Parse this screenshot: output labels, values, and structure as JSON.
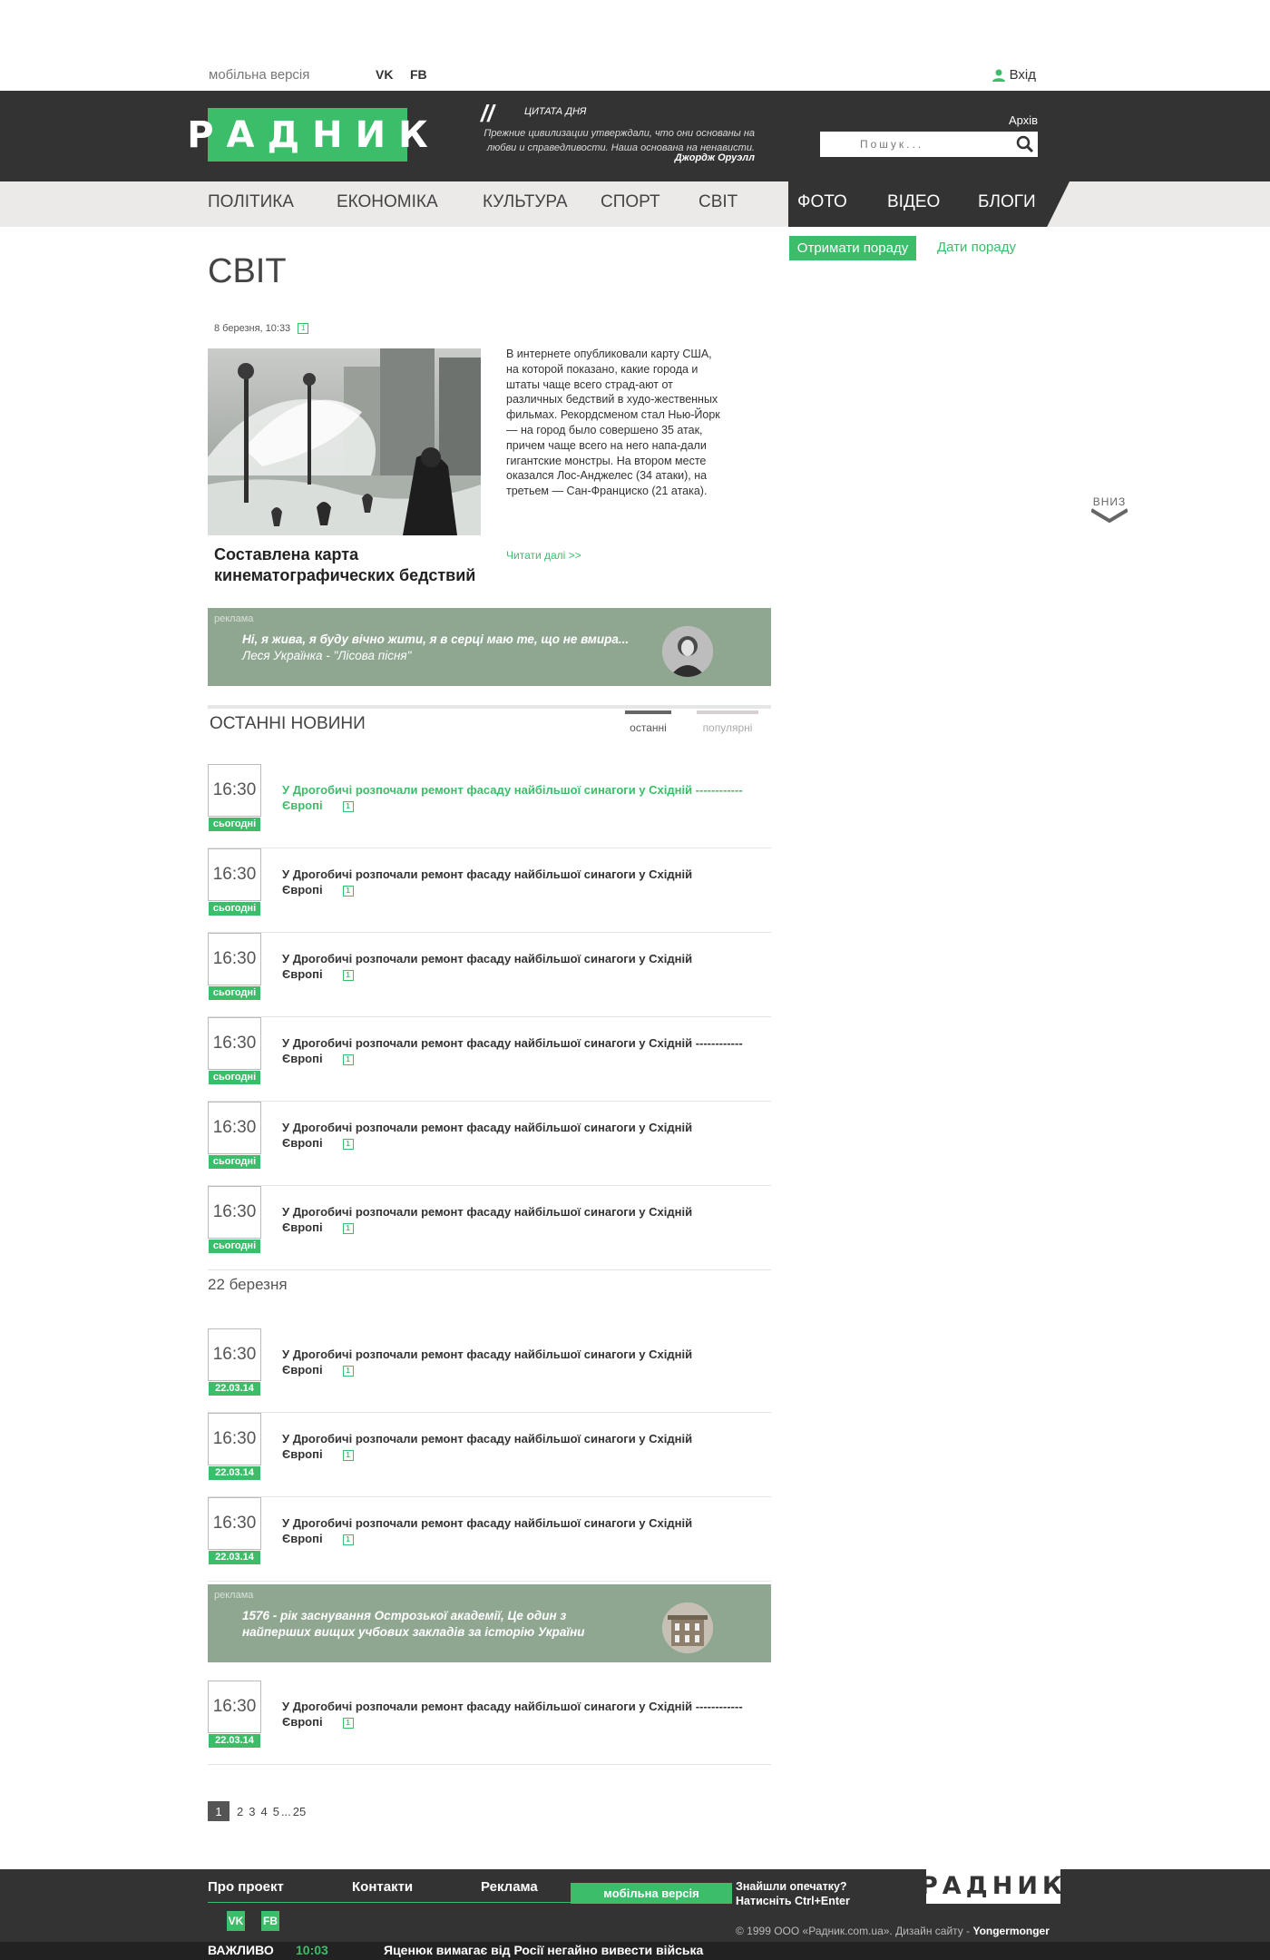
{
  "topbar": {
    "mobile_version": "мобільна версія",
    "vk": "VK",
    "fb": "FB",
    "login": "Вхід"
  },
  "header": {
    "logo": "РАДНИК",
    "quote_title": "ЦИТАТА ДНЯ",
    "quote_text": "Прежние цивилизации утверждали, что они основаны на любви и справедливости. Наша основана на ненависти.",
    "quote_author": "Джордж Оруэлл",
    "archive": "Архів",
    "search_placeholder": "Пошук..."
  },
  "nav": {
    "items": [
      "ПОЛІТИКА",
      "ЕКОНОМІКА",
      "КУЛЬТУРА",
      "СПОРТ",
      "СВІТ",
      "ФОТО",
      "ВІДЕО",
      "БЛОГИ"
    ]
  },
  "advice": {
    "get": "Отримати пораду",
    "give": "Дати пораду"
  },
  "page_title": "СВІТ",
  "featured": {
    "date": "8 березня, 10:33",
    "comments": "1",
    "title": "Составлена карта кинематографических бедствий",
    "text": "В интернете опубликовали карту США, на которой показано, какие города и штаты чаще всего страд-ают от различных бедствий в худо-жественных фильмах. Рекордсменом стал Нью-Йорк — на город было совершено 35 атак, причем чаще всего на него напа-дали гигантские монстры. На втором месте оказался Лос-Анджелес (34 атаки), на третьем — Сан-Франциско (21 атака).",
    "read_more": "Читати далі >>"
  },
  "ad1": {
    "label": "реклама",
    "line1": "Ні, я жива, я буду вічно жити, я в серці маю те, що не вмира...",
    "line2": "Леся Українка - \"Лісова пісня\""
  },
  "ad2": {
    "label": "реклама",
    "line1": "1576 - рік заснування Острозької академії, Це один з",
    "line2": "найперших вищих учбових закладів за історію України"
  },
  "news": {
    "heading": "ОСТАННІ НОВИНИ",
    "tab_latest": "останні",
    "tab_popular": "популярні",
    "date_separator": "22 березня",
    "today_rows": [
      {
        "time": "16:30",
        "day": "сьогодні",
        "title1": "У Дрогобичі розпочали ремонт фасаду найбільшої синагоги у Східній ------------",
        "title2": "Європі",
        "comments": "1"
      },
      {
        "time": "16:30",
        "day": "сьогодні",
        "title1": "У Дрогобичі розпочали ремонт фасаду найбільшої синагоги у Східній",
        "title2": "Європі",
        "comments": "1"
      },
      {
        "time": "16:30",
        "day": "сьогодні",
        "title1": "У Дрогобичі розпочали ремонт фасаду найбільшої синагоги у Східній",
        "title2": "Європі",
        "comments": "1"
      },
      {
        "time": "16:30",
        "day": "сьогодні",
        "title1": "У Дрогобичі розпочали ремонт фасаду найбільшої синагоги у Східній  ------------",
        "title2": "Європі",
        "comments": "1"
      },
      {
        "time": "16:30",
        "day": "сьогодні",
        "title1": "У Дрогобичі розпочали ремонт фасаду найбільшої синагоги у Східній",
        "title2": "Європі",
        "comments": "1"
      },
      {
        "time": "16:30",
        "day": "сьогодні",
        "title1": "У Дрогобичі розпочали ремонт фасаду найбільшої синагоги у Східній",
        "title2": "Європі",
        "comments": "1"
      }
    ],
    "past_rows": [
      {
        "time": "16:30",
        "day": "22.03.14",
        "title1": "У Дрогобичі розпочали ремонт фасаду найбільшої синагоги у Східній",
        "title2": "Європі",
        "comments": "1"
      },
      {
        "time": "16:30",
        "day": "22.03.14",
        "title1": "У Дрогобичі розпочали ремонт фасаду найбільшої синагоги у Східній",
        "title2": "Європі",
        "comments": "1"
      },
      {
        "time": "16:30",
        "day": "22.03.14",
        "title1": "У Дрогобичі розпочали ремонт фасаду найбільшої синагоги у Східній",
        "title2": "Європі",
        "comments": "1"
      },
      {
        "time": "16:30",
        "day": "22.03.14",
        "title1": "У Дрогобичі розпочали ремонт фасаду найбільшої синагоги у Східній ------------",
        "title2": "Європі",
        "comments": "1"
      }
    ]
  },
  "pager": {
    "current": "1",
    "pages": [
      "2",
      "3",
      "4",
      "5",
      "...",
      "25"
    ]
  },
  "down_button": "ВНИЗ",
  "footer": {
    "about": "Про проект",
    "contacts": "Контакти",
    "ads": "Реклама",
    "mobile": "мобільна версія",
    "typo1": "Знайшли опечатку?",
    "typo2": "Натисніть Ctrl+Enter",
    "logo": "РАДНИК",
    "vk": "VK",
    "fb": "FB",
    "copyright": "© 1999 ООО «Радник.com.ua». Дизайн сайту - ",
    "designer": "Yongermonger"
  },
  "ticker": {
    "label": "ВАЖЛИВО",
    "time": "10:03",
    "text": "Яценюк вимагає від Росії негайно вивести війська"
  },
  "colors": {
    "accent": "#3bbd6a",
    "dark": "#333333",
    "ad_bg": "#8fa791"
  }
}
